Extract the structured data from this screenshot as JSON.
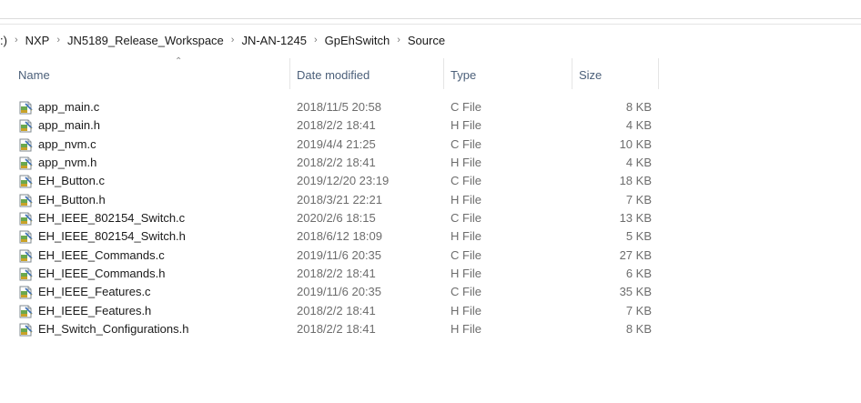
{
  "breadcrumb": [
    ":)",
    "NXP",
    "JN5189_Release_Workspace",
    "JN-AN-1245",
    "GpEhSwitch",
    "Source"
  ],
  "columns": {
    "name": "Name",
    "date": "Date modified",
    "type": "Type",
    "size": "Size"
  },
  "files": [
    {
      "name": "app_main.c",
      "date": "2018/11/5 20:58",
      "type": "C File",
      "size": "8 KB"
    },
    {
      "name": "app_main.h",
      "date": "2018/2/2 18:41",
      "type": "H File",
      "size": "4 KB"
    },
    {
      "name": "app_nvm.c",
      "date": "2019/4/4 21:25",
      "type": "C File",
      "size": "10 KB"
    },
    {
      "name": "app_nvm.h",
      "date": "2018/2/2 18:41",
      "type": "H File",
      "size": "4 KB"
    },
    {
      "name": "EH_Button.c",
      "date": "2019/12/20 23:19",
      "type": "C File",
      "size": "18 KB"
    },
    {
      "name": "EH_Button.h",
      "date": "2018/3/21 22:21",
      "type": "H File",
      "size": "7 KB"
    },
    {
      "name": "EH_IEEE_802154_Switch.c",
      "date": "2020/2/6 18:15",
      "type": "C File",
      "size": "13 KB"
    },
    {
      "name": "EH_IEEE_802154_Switch.h",
      "date": "2018/6/12 18:09",
      "type": "H File",
      "size": "5 KB"
    },
    {
      "name": "EH_IEEE_Commands.c",
      "date": "2019/11/6 20:35",
      "type": "C File",
      "size": "27 KB"
    },
    {
      "name": "EH_IEEE_Commands.h",
      "date": "2018/2/2 18:41",
      "type": "H File",
      "size": "6 KB"
    },
    {
      "name": "EH_IEEE_Features.c",
      "date": "2019/11/6 20:35",
      "type": "C File",
      "size": "35 KB"
    },
    {
      "name": "EH_IEEE_Features.h",
      "date": "2018/2/2 18:41",
      "type": "H File",
      "size": "7 KB"
    },
    {
      "name": "EH_Switch_Configurations.h",
      "date": "2018/2/2 18:41",
      "type": "H File",
      "size": "8 KB"
    }
  ],
  "file_icon": "text-file-icon"
}
